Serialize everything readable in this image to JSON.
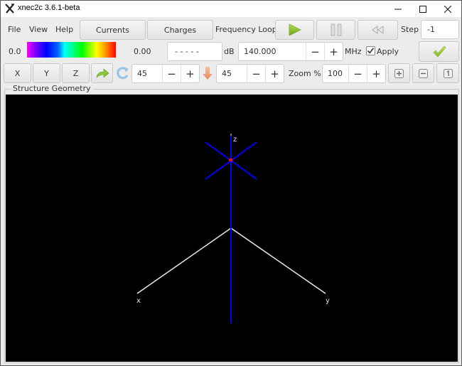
{
  "window": {
    "title": "xnec2c 3.6.1-beta",
    "controls": [
      "minimize",
      "maximize",
      "close"
    ]
  },
  "menubar": {
    "items": [
      "File",
      "View",
      "Help"
    ]
  },
  "toolbar1": {
    "currents_label": "Currents",
    "charges_label": "Charges",
    "frequency_loop_label": "Frequency Loop",
    "play_icon": "play-icon",
    "pause_icon": "pause-icon",
    "rewind_icon": "rewind-icon",
    "step_label": "Step",
    "step_value": "-1"
  },
  "toolbar2": {
    "scale_min": "0.0",
    "scale_max": "0.00",
    "gain_value": "- - - - -",
    "gain_unit": "dB",
    "frequency_value": "140.000",
    "frequency_unit": "MHz",
    "apply_label": "Apply",
    "apply_checked": true,
    "minus": "−",
    "plus": "+"
  },
  "toolbar3": {
    "x_label": "X",
    "y_label": "Y",
    "z_label": "Z",
    "rotate_value": "45",
    "incline_value": "45",
    "zoom_label": "Zoom %",
    "zoom_value": "100",
    "minus": "−",
    "plus": "+"
  },
  "structure": {
    "frame_label": "Structure Geometry",
    "axis_labels": {
      "x": "x",
      "y": "y",
      "z": "z"
    },
    "colors": {
      "background": "#000000",
      "axes": "#e0e0e0",
      "wire": "#0000ff",
      "excitation": "#ff0000"
    }
  }
}
